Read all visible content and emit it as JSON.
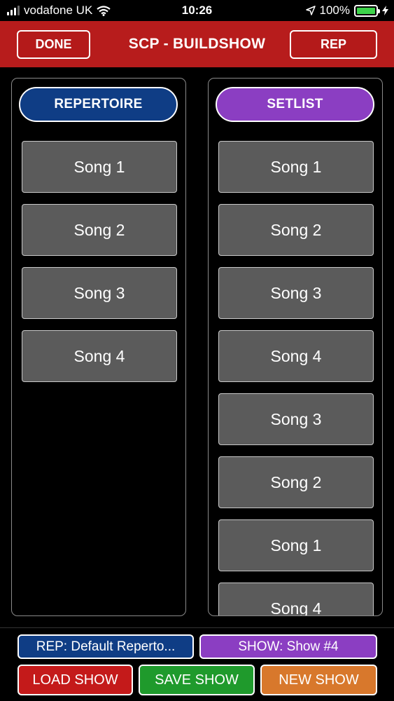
{
  "status_bar": {
    "carrier": "vodafone UK",
    "time": "10:26",
    "battery_percent": "100%",
    "signal_bars_filled": 3,
    "signal_bars_total": 4
  },
  "header": {
    "title": "SCP - BUILDSHOW",
    "done_label": "DONE",
    "rep_label": "REP",
    "color": "#b71c1c"
  },
  "repertoire": {
    "label": "REPERTOIRE",
    "color": "#0f3d85",
    "songs": [
      "Song 1",
      "Song 2",
      "Song 3",
      "Song 4"
    ]
  },
  "setlist": {
    "label": "SETLIST",
    "color": "#8b3ec2",
    "songs": [
      "Song 1",
      "Song 2",
      "Song 3",
      "Song 4",
      "Song 3",
      "Song 2",
      "Song 1",
      "Song 4"
    ]
  },
  "footer": {
    "rep_selector": "REP: Default Reperto...",
    "show_selector": "SHOW: Show #4",
    "load_label": "LOAD SHOW",
    "save_label": "SAVE SHOW",
    "new_label": "NEW SHOW",
    "load_color": "#c41a1a",
    "save_color": "#1f9a2c",
    "new_color": "#d8782c"
  }
}
